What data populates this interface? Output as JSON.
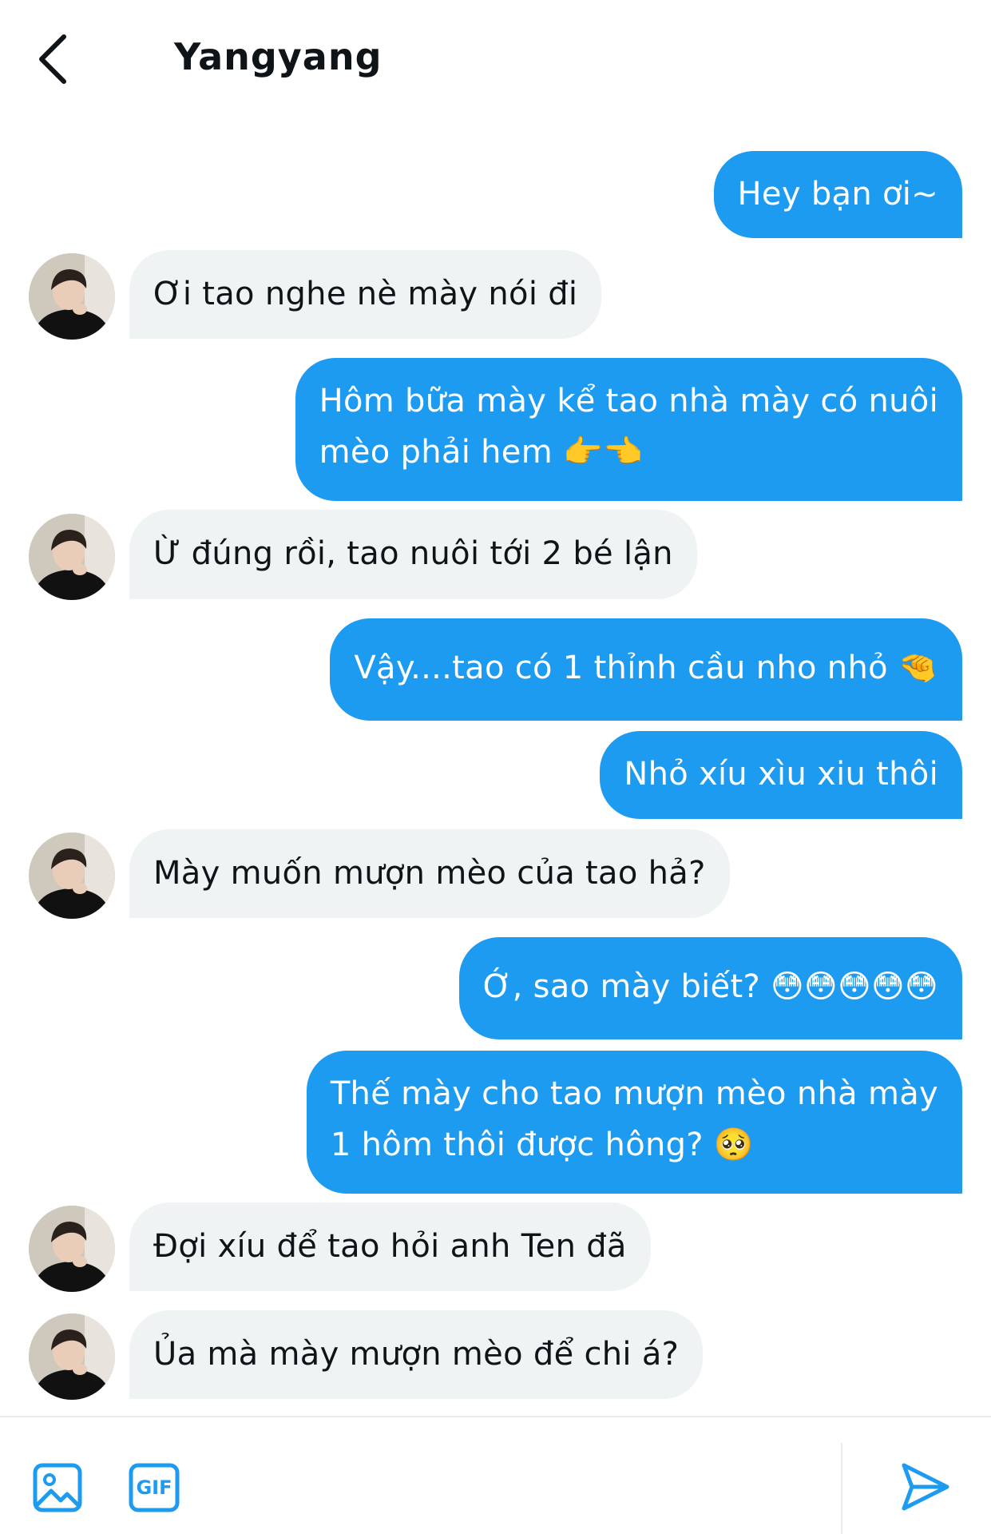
{
  "header": {
    "title": "Yangyang"
  },
  "messages": [
    {
      "side": "out",
      "text": "Hey bạn ơi~"
    },
    {
      "side": "in",
      "text": "Ơi tao nghe nè mày nói đi"
    },
    {
      "side": "out",
      "text": "Hôm bữa mày kể tao nhà mày có nuôi",
      "text2": "mèo phải hem 👉👈"
    },
    {
      "side": "in",
      "text": "Ừ đúng rồi, tao nuôi tới 2 bé lận"
    },
    {
      "side": "out",
      "text": "Vậy....tao có 1 thỉnh cầu nho nhỏ 🤏"
    },
    {
      "side": "out",
      "text": "Nhỏ xíu xìu xiu thôi"
    },
    {
      "side": "in",
      "text": "Mày muốn mượn mèo của tao hả?"
    },
    {
      "side": "out",
      "text": "Ớ, sao mày biết? 😳😳😳😳😳"
    },
    {
      "side": "out",
      "text": "Thế mày cho tao mượn mèo nhà mày",
      "text2": "1 hôm thôi được hông? 🥺"
    },
    {
      "side": "in",
      "text": "Đợi xíu để tao hỏi anh Ten đã"
    },
    {
      "side": "in",
      "text": "Ủa mà mày mượn mèo để chi á?"
    }
  ],
  "composer": {
    "gif_label": "GIF",
    "icons": [
      "image-icon",
      "gif-icon",
      "send-icon"
    ]
  },
  "colors": {
    "accent": "#1d9bf0",
    "incoming": "#eff3f4"
  }
}
